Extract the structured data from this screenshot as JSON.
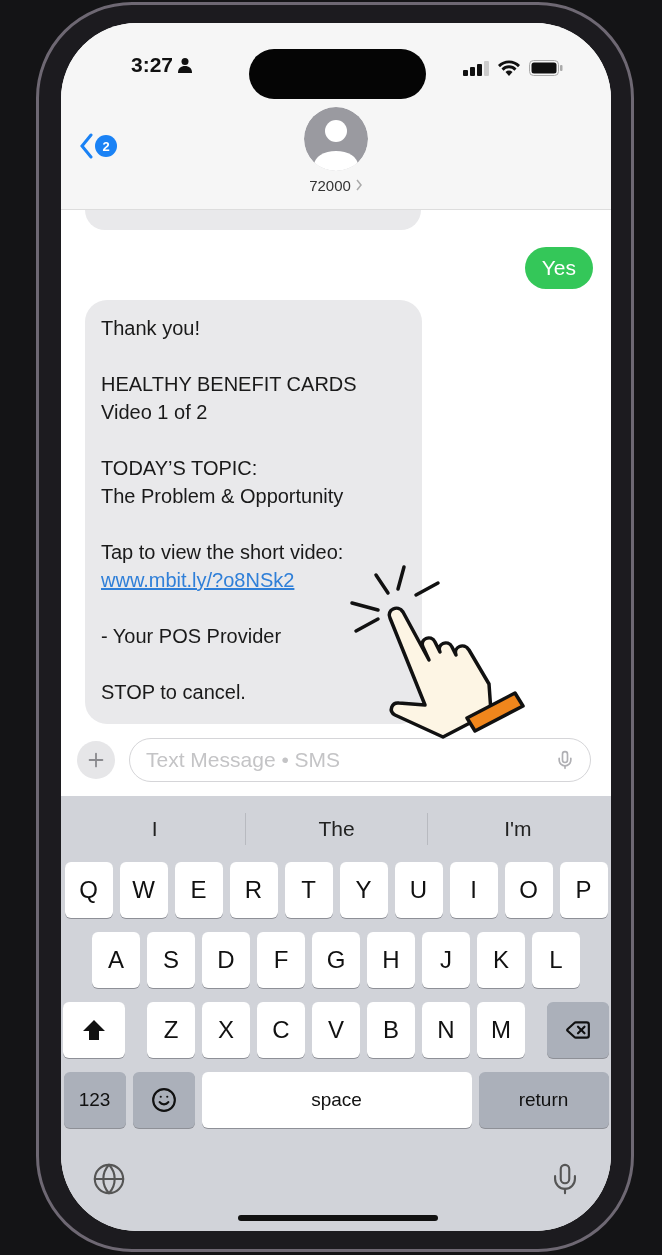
{
  "status_bar": {
    "time": "3:27"
  },
  "header": {
    "back_badge": "2",
    "contact": "72000"
  },
  "messages": [
    {
      "kind": "clipped"
    },
    {
      "kind": "sent",
      "paragraphs": [
        {
          "lines": [
            "Yes"
          ]
        }
      ]
    },
    {
      "kind": "received",
      "paragraphs": [
        {
          "lines": [
            "Thank you!"
          ]
        },
        {
          "lines": [
            "HEALTHY BENEFIT CARDS",
            "Video 1 of 2"
          ]
        },
        {
          "lines": [
            "TODAY’S TOPIC:",
            "The Problem & Opportunity"
          ]
        },
        {
          "lines": [
            "Tap to view the short video:"
          ],
          "link": "www.mbit.ly/?o8NSk2"
        },
        {
          "lines": [
            "- Your POS Provider"
          ]
        },
        {
          "lines": [
            "STOP to cancel."
          ]
        }
      ]
    }
  ],
  "composer": {
    "placeholder": "Text Message • SMS"
  },
  "keyboard": {
    "suggestions": [
      "I",
      "The",
      "I'm"
    ],
    "rows": [
      [
        "Q",
        "W",
        "E",
        "R",
        "T",
        "Y",
        "U",
        "I",
        "O",
        "P"
      ],
      [
        "A",
        "S",
        "D",
        "F",
        "G",
        "H",
        "J",
        "K",
        "L"
      ],
      [
        "Z",
        "X",
        "C",
        "V",
        "B",
        "N",
        "M"
      ]
    ],
    "numbers": "123",
    "space": "space",
    "return": "return"
  }
}
